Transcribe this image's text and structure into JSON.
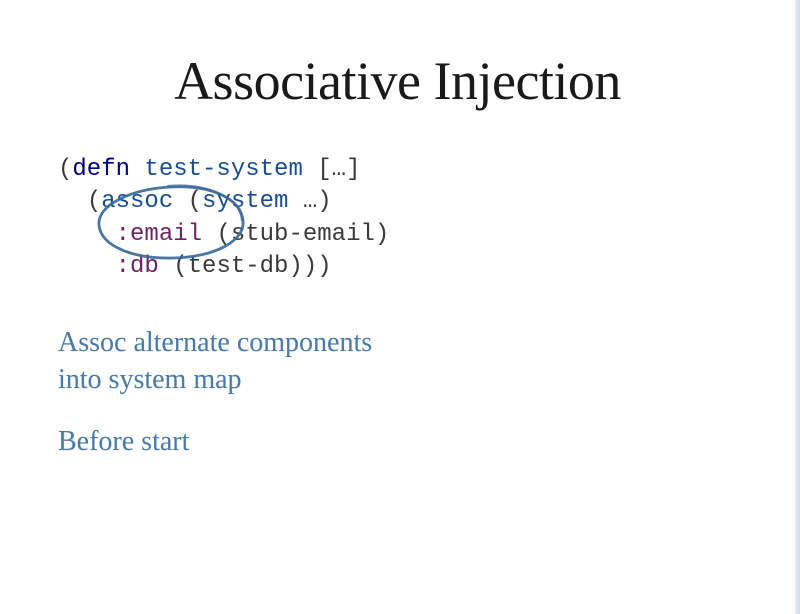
{
  "title": "Associative Injection",
  "code": {
    "l1_open": "(",
    "l1_defn": "defn",
    "l1_space": " ",
    "l1_fn": "test-system",
    "l1_rest": " […]",
    "l2_indent": "  ",
    "l2_open": "(",
    "l2_assoc": "assoc ",
    "l2_open2": "(",
    "l2_system": "system",
    "l2_rest": " …)",
    "l3_indent": "    ",
    "l3_kw": ":email",
    "l3_space": " ",
    "l3_open": "(",
    "l3_fn": "stub-email",
    "l3_close": ")",
    "l4_indent": "    ",
    "l4_kw": ":db",
    "l4_space": " ",
    "l4_open": "(",
    "l4_fn": "test-db",
    "l4_close": ")))"
  },
  "annotation1_line1": "Assoc alternate components",
  "annotation1_line2": "into system map",
  "annotation2": "Before start"
}
